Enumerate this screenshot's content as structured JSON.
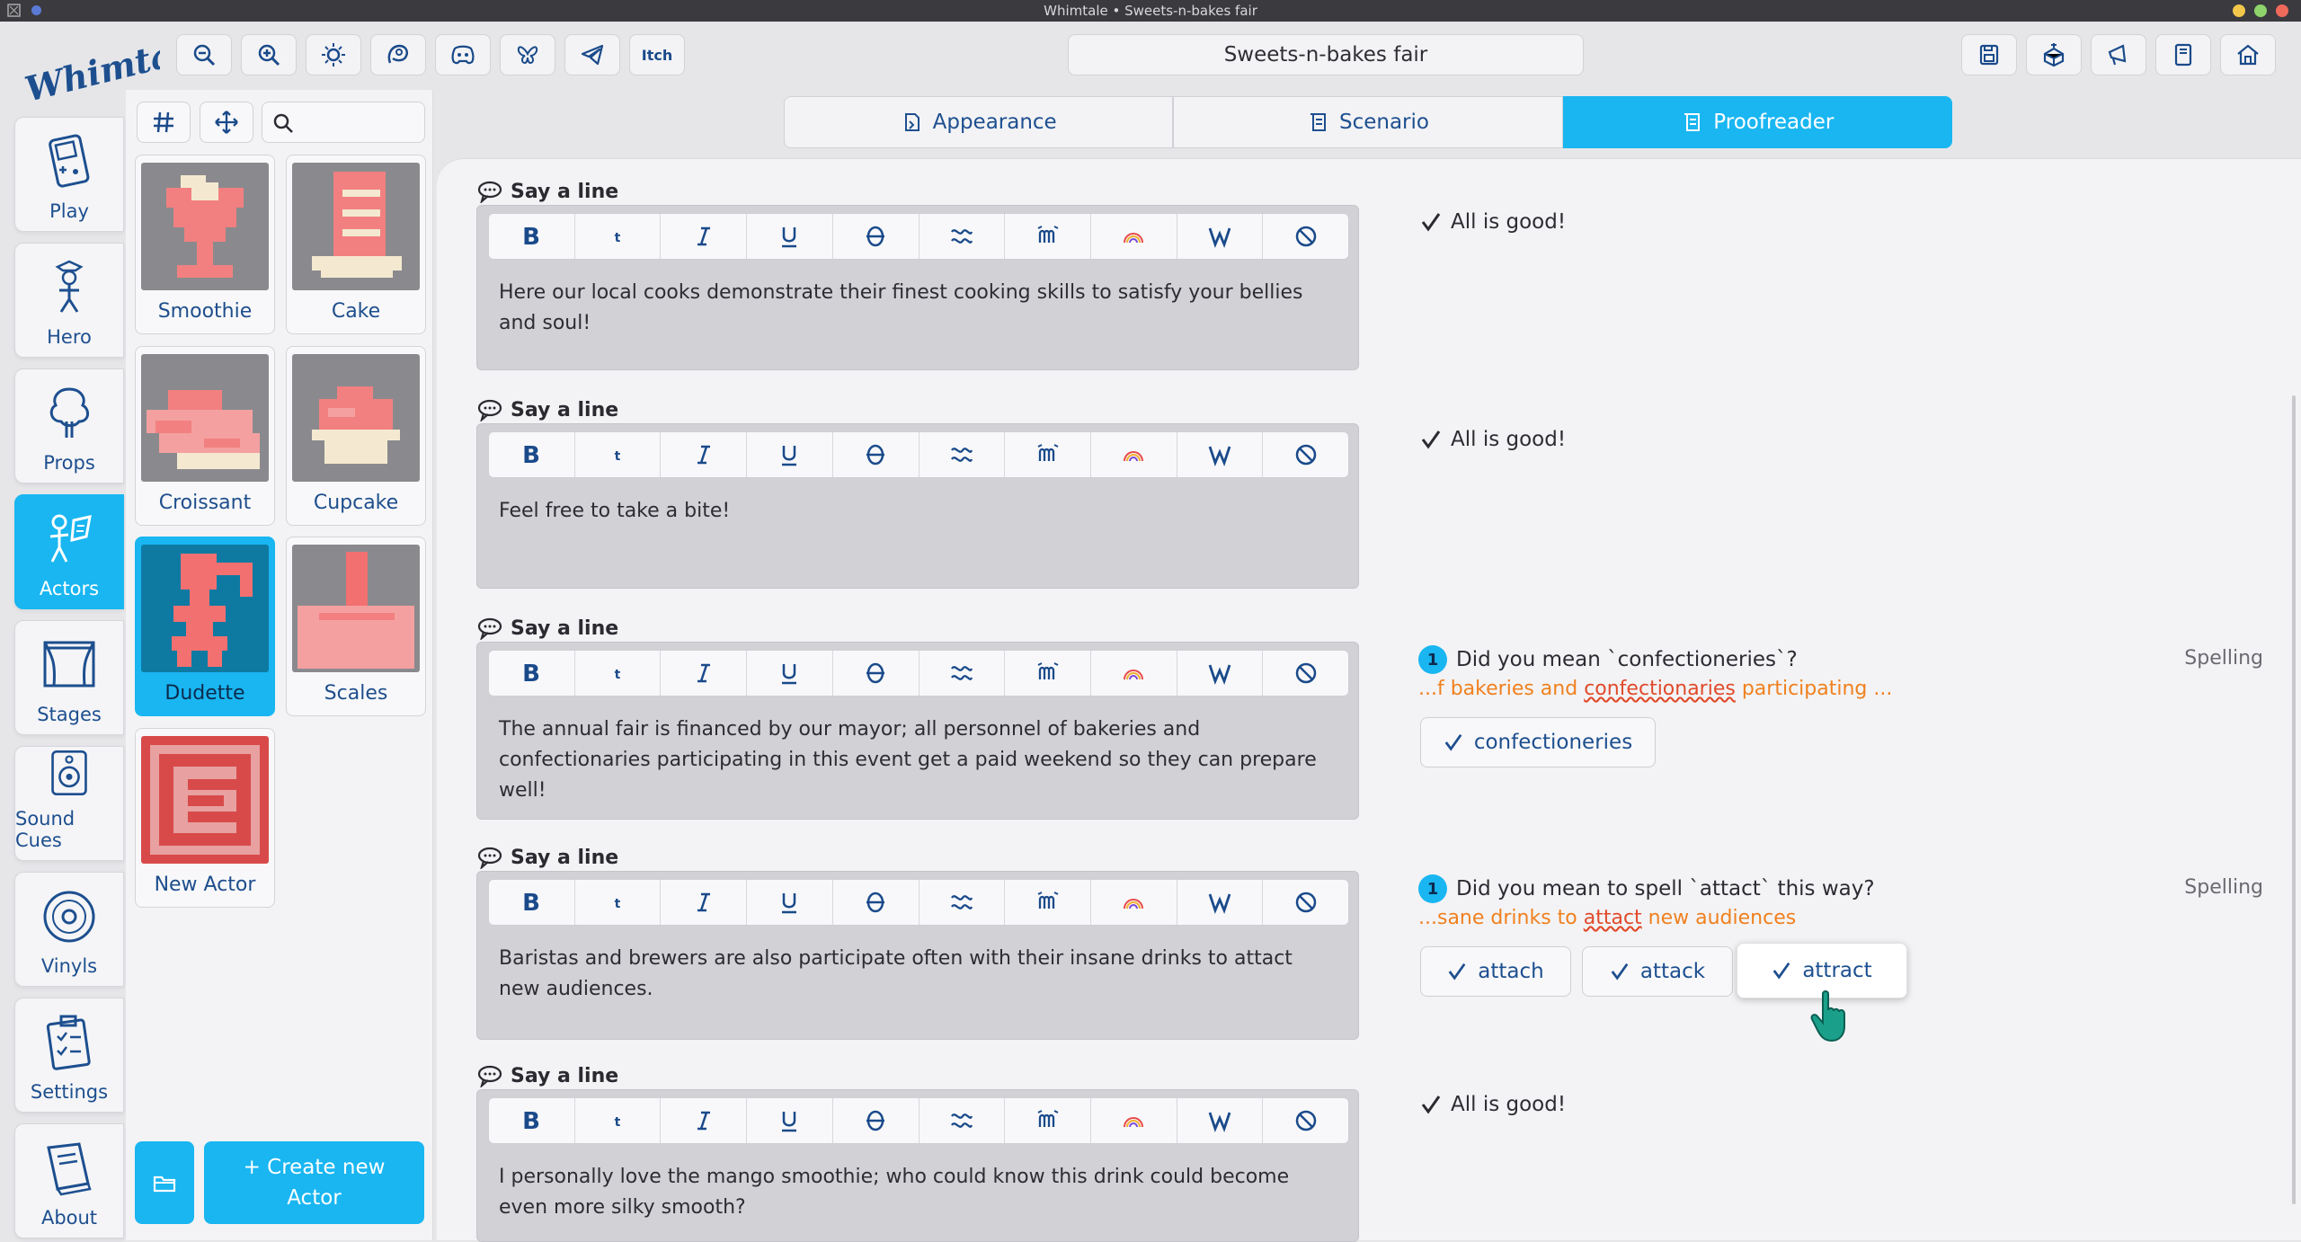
{
  "window": {
    "title": "Whimtale • Sweets-n-bakes fair"
  },
  "app": {
    "logo": "Whimtale",
    "project_name": "Sweets-n-bakes fair"
  },
  "toolbar_left": [
    "zoom-out-icon",
    "zoom-in-icon",
    "theme-icon",
    "patreon-icon",
    "discord-icon",
    "bluesky-icon",
    "telegram-icon",
    "itch"
  ],
  "toolbar_right": [
    "save-icon",
    "build-icon",
    "megaphone-icon",
    "book-icon",
    "home-icon"
  ],
  "itch_label": "Itch",
  "nav": [
    {
      "label": "Play",
      "icon": "gamepad-icon"
    },
    {
      "label": "Hero",
      "icon": "hero-icon"
    },
    {
      "label": "Props",
      "icon": "tree-icon"
    },
    {
      "label": "Actors",
      "icon": "actor-icon",
      "active": true
    },
    {
      "label": "Stages",
      "icon": "stage-icon"
    },
    {
      "label": "Sound Cues",
      "icon": "speaker-icon"
    },
    {
      "label": "Vinyls",
      "icon": "vinyl-icon"
    },
    {
      "label": "Settings",
      "icon": "clipboard-icon"
    },
    {
      "label": "About",
      "icon": "book-icon"
    }
  ],
  "actors": {
    "search_placeholder": "",
    "items": [
      {
        "name": "Smoothie"
      },
      {
        "name": "Cake"
      },
      {
        "name": "Croissant"
      },
      {
        "name": "Cupcake"
      },
      {
        "name": "Dudette",
        "selected": true
      },
      {
        "name": "Scales"
      },
      {
        "name": "New Actor"
      }
    ],
    "create_line1": "+ Create new",
    "create_line2": "Actor"
  },
  "tabs": [
    {
      "label": "Appearance"
    },
    {
      "label": "Scenario"
    },
    {
      "label": "Proofreader",
      "active": true
    }
  ],
  "lines": [
    {
      "heading": "Say a line",
      "text": "Here our local cooks demonstrate their finest cooking skills to satisfy your bellies and soul!",
      "status": "All is good!"
    },
    {
      "heading": "Say a line",
      "text": "Feel free to take a bite!",
      "status": "All is good!"
    },
    {
      "heading": "Say a line",
      "text": "The annual fair is financed by our mayor; all personnel of bakeries and confectionaries participating in this event get a paid weekend so they can prepare well!",
      "issue": {
        "count": "1",
        "question": "Did you mean `confectioneries`?",
        "category": "Spelling",
        "context_before": "...f bakeries and ",
        "context_word": "confectionaries",
        "context_after": " participating ...",
        "suggestions": [
          "confectioneries"
        ]
      }
    },
    {
      "heading": "Say a line",
      "text": "Baristas and brewers are also participate often with their insane drinks to attact new audiences.",
      "issue": {
        "count": "1",
        "question": "Did you mean to spell `attact` this way?",
        "category": "Spelling",
        "context_before": "...sane drinks to ",
        "context_word": "attact",
        "context_after": " new audiences",
        "suggestions": [
          "attach",
          "attack",
          "attract"
        ]
      }
    },
    {
      "heading": "Say a line",
      "text": "I personally love the mango smoothie; who could know this drink could become even more silky smooth?",
      "status": "All is good!"
    }
  ],
  "format_buttons": [
    "bold",
    "tiny",
    "italic",
    "underline",
    "strike",
    "wavy",
    "shake",
    "rainbow",
    "wiggle",
    "clear"
  ],
  "colors": {
    "accent": "#19b6f1",
    "text_blue": "#1d4f8f",
    "warning": "#f0801e"
  }
}
